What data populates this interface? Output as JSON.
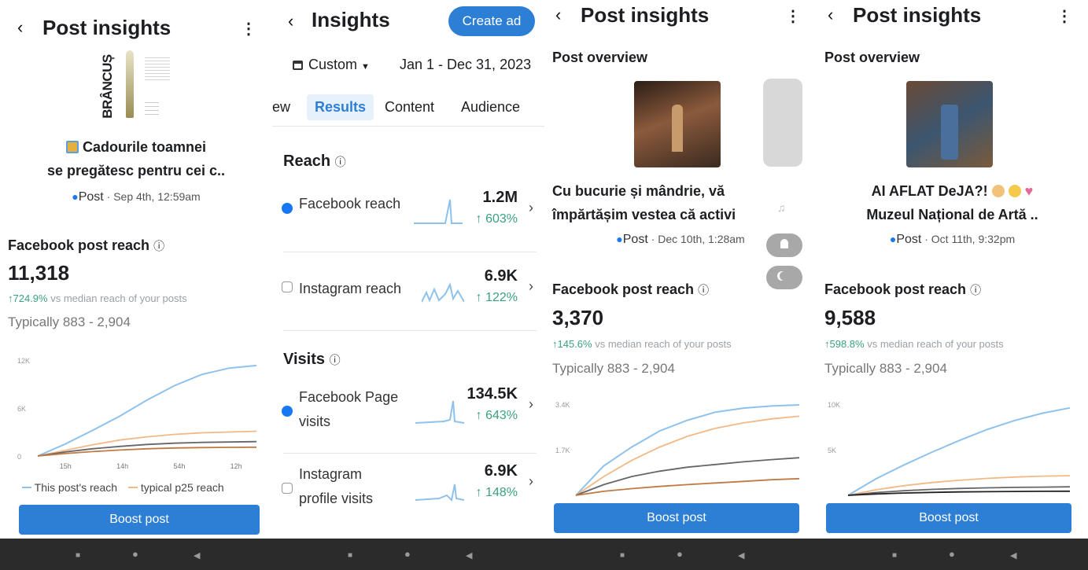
{
  "panel1": {
    "title": "Post insights",
    "logo_text": "BRÂNCUȘ",
    "caption_line1": "Cadourile toamnei",
    "caption_line2": "se pregătesc pentru cei c..",
    "post_type": "Post",
    "post_date": " · Sep 4th, 12:59am",
    "reach_label": "Facebook post reach",
    "reach_value": "11,318",
    "vs_pct": "↑724.9%",
    "vs_text": " vs median reach of your posts",
    "typical": "Typically 883 - 2,904",
    "legend_this": "This post's reach",
    "legend_typ": "typical p25 reach",
    "boost": "Boost post"
  },
  "panel2": {
    "title": "Insights",
    "create_ad": "Create ad",
    "date_filter": "Custom",
    "date_range": "Jan 1 - Dec 31, 2023",
    "tabs": [
      "ew",
      "Results",
      "Content",
      "Audience"
    ],
    "section_reach": "Reach",
    "section_visits": "Visits",
    "metrics": [
      {
        "name": "Facebook reach",
        "value": "1.2M",
        "change": "↑ 603%"
      },
      {
        "name": "Instagram reach",
        "value": "6.9K",
        "change": "↑ 122%"
      },
      {
        "name": "Facebook Page",
        "name2": "visits",
        "value": "134.5K",
        "change": "↑ 643%"
      },
      {
        "name": "Instagram",
        "name2": "profile visits",
        "value": "6.9K",
        "change": "↑ 148%"
      }
    ]
  },
  "panel3": {
    "title": "Post insights",
    "overview": "Post overview",
    "caption_line1": "Cu bucurie și mândrie, vă",
    "caption_line2": "împărtășim vestea că activi",
    "post_type": "Post",
    "post_date": " · Dec 10th, 1:28am",
    "reach_label": "Facebook post reach",
    "reach_value": "3,370",
    "vs_pct": "↑145.6%",
    "vs_text": " vs median reach of your posts",
    "typical": "Typically 883 - 2,904",
    "boost": "Boost post"
  },
  "panel4": {
    "title": "Post insights",
    "overview": "Post overview",
    "caption_line1": "AI AFLAT DeJA?!",
    "caption_line2": "Muzeul Național de Artă ..",
    "post_type": "Post",
    "post_date": " · Oct 11th, 9:32pm",
    "reach_label": "Facebook post reach",
    "reach_value": "9,588",
    "vs_pct": "↑598.8%",
    "vs_text": " vs median reach of your posts",
    "typical": "Typically 883 - 2,904",
    "boost": "Boost post"
  },
  "chart_data": [
    {
      "type": "line",
      "ylabels": [
        "12K",
        "6K",
        "0"
      ],
      "xlabels": [
        "15h",
        "14h",
        "54h",
        "12h"
      ],
      "series": [
        {
          "name": "This post's reach",
          "color": "#8ec2ec",
          "values": [
            0,
            1500,
            3200,
            5000,
            7000,
            8800,
            10200,
            11000,
            11318
          ]
        },
        {
          "name": "typical p25 reach",
          "color": "#f2b987",
          "values": [
            0,
            700,
            1400,
            2000,
            2400,
            2700,
            2900,
            3000,
            3100
          ]
        },
        {
          "color": "#666666",
          "values": [
            0,
            500,
            900,
            1200,
            1450,
            1600,
            1700,
            1750,
            1800
          ]
        },
        {
          "color": "#c07a45",
          "values": [
            0,
            300,
            550,
            750,
            900,
            1000,
            1050,
            1080,
            1100
          ]
        }
      ]
    },
    {
      "type": "line",
      "ylabels": [
        "3.4K",
        "1.7K"
      ],
      "series": [
        {
          "color": "#8ec2ec",
          "values": [
            0,
            1100,
            1800,
            2400,
            2800,
            3100,
            3250,
            3330,
            3370
          ]
        },
        {
          "color": "#f2b987",
          "values": [
            0,
            700,
            1300,
            1800,
            2200,
            2500,
            2700,
            2850,
            2950
          ]
        },
        {
          "color": "#666666",
          "values": [
            0,
            400,
            700,
            900,
            1050,
            1150,
            1250,
            1330,
            1400
          ]
        },
        {
          "color": "#c07a45",
          "values": [
            0,
            150,
            250,
            330,
            400,
            460,
            520,
            580,
            620
          ]
        }
      ]
    },
    {
      "type": "line",
      "ylabels": [
        "10K",
        "5K"
      ],
      "series": [
        {
          "color": "#8ec2ec",
          "values": [
            0,
            1800,
            3300,
            4700,
            6000,
            7200,
            8200,
            9000,
            9588
          ]
        },
        {
          "color": "#f2b987",
          "values": [
            0,
            600,
            1050,
            1400,
            1650,
            1850,
            2000,
            2100,
            2150
          ]
        },
        {
          "color": "#666666",
          "values": [
            0,
            300,
            500,
            650,
            750,
            820,
            870,
            900,
            930
          ]
        },
        {
          "color": "#222222",
          "values": [
            0,
            150,
            250,
            320,
            370,
            400,
            420,
            440,
            450
          ]
        }
      ]
    }
  ]
}
